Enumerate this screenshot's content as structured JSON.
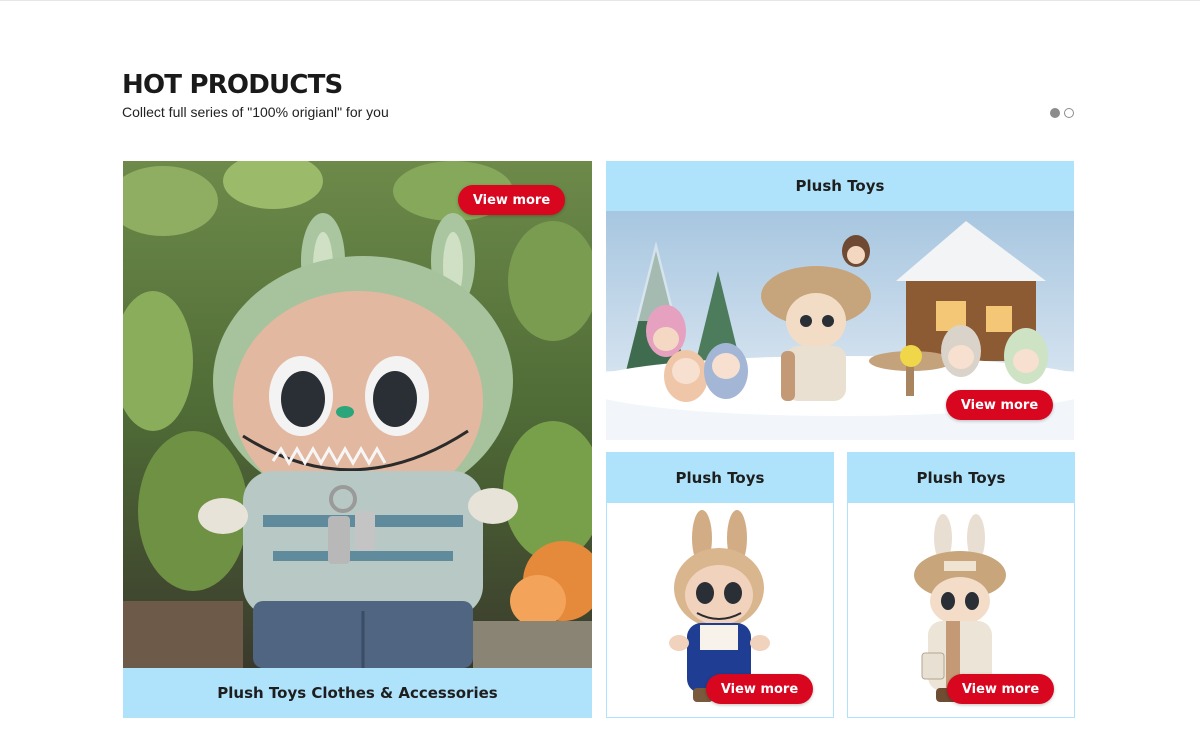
{
  "section": {
    "title": "HOT PRODUCTS",
    "subtitle": "Collect full series of \"100% origianl\" for you"
  },
  "pager": {
    "pages": 2,
    "active": 1
  },
  "cards": {
    "large": {
      "title": "Plush Toys Clothes & Accessories",
      "button": "View more",
      "image": "doll-in-green-hood-among-plants"
    },
    "wide": {
      "title": "Plush Toys",
      "button": "View more",
      "image": "doll-group-snowy-cabin-scene"
    },
    "small1": {
      "title": "Plush Toys",
      "button": "View more",
      "image": "doll-blue-overalls"
    },
    "small2": {
      "title": "Plush Toys",
      "button": "View more",
      "image": "doll-bucket-hat-scarf"
    }
  },
  "colors": {
    "accent": "#d9061f",
    "title_band": "#aee3fb"
  }
}
